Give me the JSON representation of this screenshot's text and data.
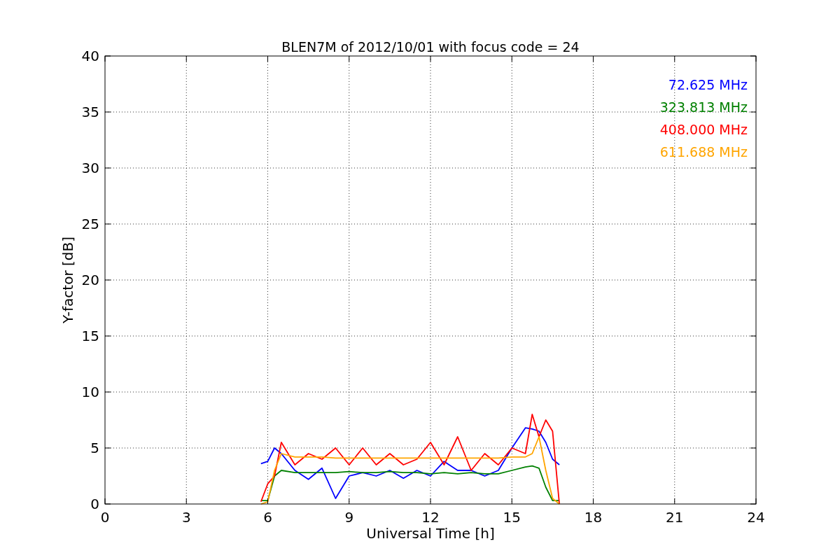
{
  "figure": {
    "chart_data": {
      "type": "line",
      "title": "BLEN7M of 2012/10/01 with focus code = 24",
      "xlabel": "Universal Time [h]",
      "ylabel": "Y-factor [dB]",
      "x": [
        5.75,
        6,
        6.25,
        6.5,
        7,
        7.5,
        8,
        8.5,
        9,
        9.5,
        10,
        10.5,
        11,
        11.5,
        12,
        12.5,
        13,
        13.5,
        14,
        14.5,
        15,
        15.5,
        15.75,
        16,
        16.25,
        16.5,
        16.75
      ],
      "series": [
        {
          "name": "72.625 MHz",
          "color": "#0000ff",
          "values": [
            3.6,
            3.8,
            5.0,
            4.5,
            3.0,
            2.2,
            3.2,
            0.5,
            2.5,
            2.8,
            2.5,
            3.0,
            2.3,
            3.0,
            2.5,
            3.8,
            3.0,
            3.0,
            2.5,
            3.0,
            5.0,
            6.8,
            6.7,
            6.5,
            5.5,
            4.0,
            3.5
          ]
        },
        {
          "name": "323.813 MHz",
          "color": "#008000",
          "values": [
            0.3,
            0.3,
            2.5,
            3.0,
            2.8,
            2.8,
            2.8,
            2.8,
            2.9,
            2.8,
            2.8,
            2.9,
            2.8,
            2.8,
            2.7,
            2.8,
            2.7,
            2.8,
            2.7,
            2.7,
            3.0,
            3.3,
            3.4,
            3.2,
            1.5,
            0.3,
            0.3
          ]
        },
        {
          "name": "408.000 MHz",
          "color": "#ff0000",
          "values": [
            0.2,
            1.8,
            2.5,
            5.5,
            3.5,
            4.5,
            4.0,
            5.0,
            3.5,
            5.0,
            3.5,
            4.5,
            3.5,
            4.0,
            5.5,
            3.5,
            6.0,
            3.0,
            4.5,
            3.5,
            5.0,
            4.5,
            8.0,
            6.0,
            7.5,
            6.5,
            0.0
          ]
        },
        {
          "name": "611.688 MHz",
          "color": "#ffa500",
          "values": [
            0.0,
            0.2,
            3.0,
            4.5,
            4.2,
            4.2,
            4.2,
            4.1,
            4.1,
            4.1,
            4.1,
            4.1,
            4.1,
            4.1,
            4.1,
            4.1,
            4.1,
            4.1,
            4.1,
            4.1,
            4.2,
            4.2,
            4.5,
            6.0,
            3.0,
            0.5,
            0.0
          ]
        }
      ],
      "grid": true,
      "xlim": [
        0,
        24
      ],
      "ylim": [
        0,
        40
      ],
      "xticks": [
        0,
        3,
        6,
        9,
        12,
        15,
        18,
        21,
        24
      ],
      "yticks": [
        0,
        5,
        10,
        15,
        20,
        25,
        30,
        35,
        40
      ]
    }
  }
}
